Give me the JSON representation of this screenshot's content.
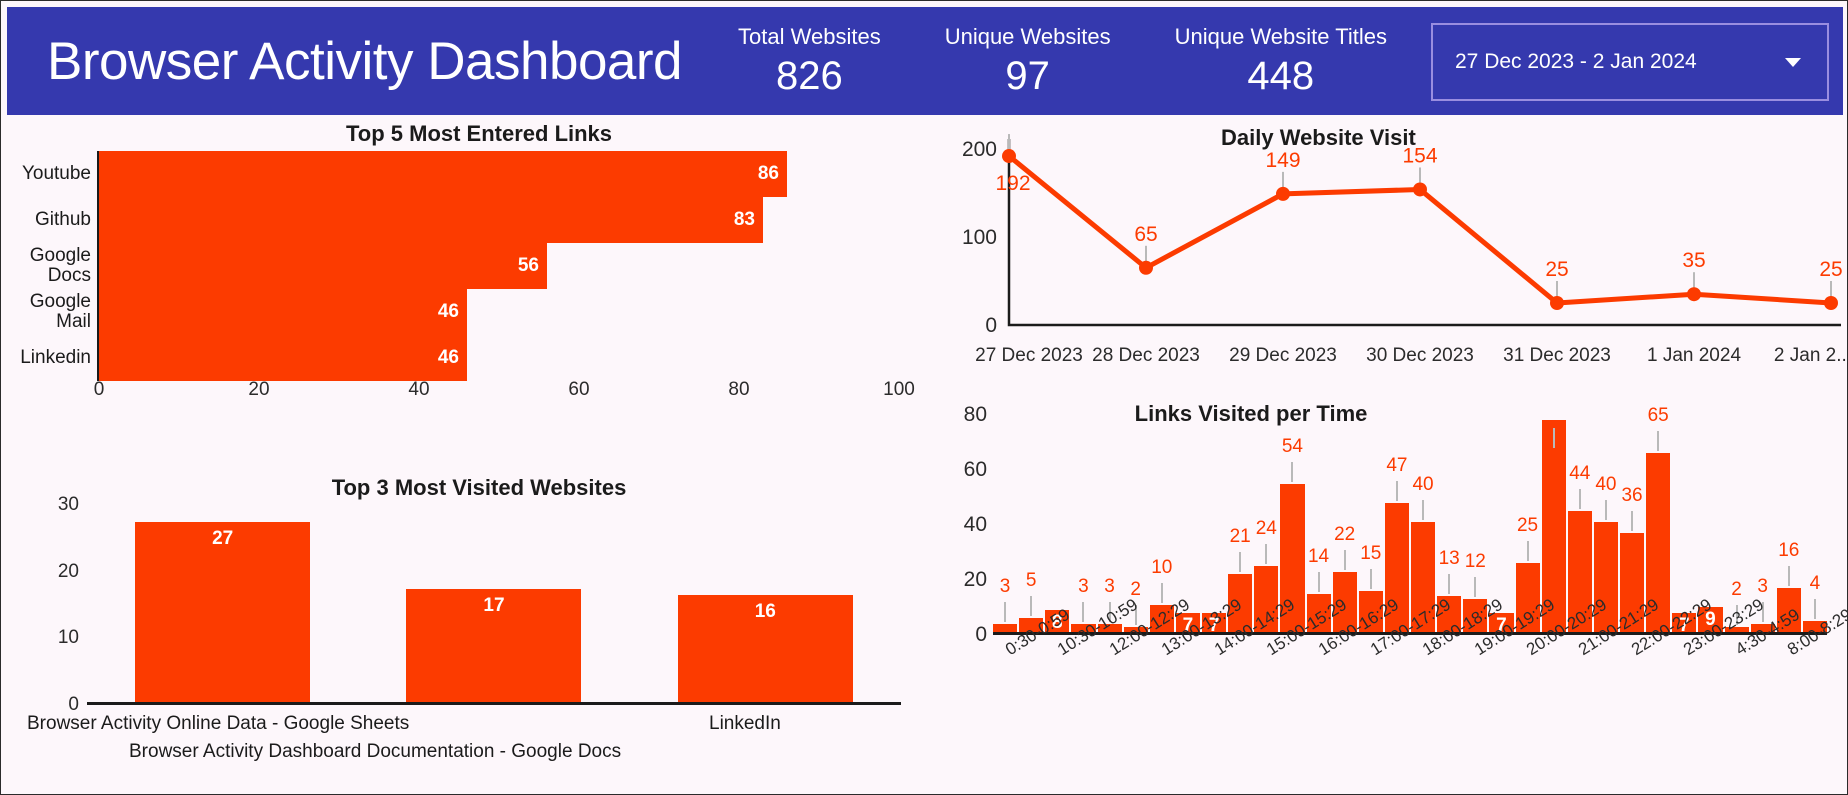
{
  "header": {
    "title": "Browser Activity Dashboard",
    "kpis": [
      {
        "label": "Total Websites",
        "value": "826"
      },
      {
        "label": "Unique Websites",
        "value": "97"
      },
      {
        "label": "Unique Website Titles",
        "value": "448"
      }
    ],
    "date_range": "27 Dec 2023 - 2 Jan 2024",
    "caret_icon": "chevron-down-icon",
    "background_color": "#3539AE",
    "accent_color": "#FC3B00"
  },
  "chart_data": [
    {
      "id": "top5_entered_links",
      "type": "bar",
      "orientation": "horizontal",
      "title": "Top 5 Most Entered Links",
      "categories": [
        "Youtube",
        "Github",
        "Google Docs",
        "Google Mail",
        "Linkedin"
      ],
      "values": [
        86,
        83,
        56,
        46,
        46
      ],
      "xlabel": "",
      "ylabel": "",
      "xlim": [
        0,
        100
      ],
      "xticks": [
        0,
        20,
        40,
        60,
        80,
        100
      ],
      "grid": false,
      "legend": false,
      "bar_color": "#FC3B00"
    },
    {
      "id": "top3_most_visited_websites",
      "type": "bar",
      "orientation": "vertical",
      "title": "Top 3 Most Visited Websites",
      "categories": [
        "Browser Activity Online Data - Google Sheets",
        "Browser Activity Dashboard Documentation - Google Docs",
        "LinkedIn"
      ],
      "values": [
        27,
        17,
        16
      ],
      "xlabel": "",
      "ylabel": "",
      "ylim": [
        0,
        30
      ],
      "yticks": [
        0,
        10,
        20,
        30
      ],
      "grid": false,
      "legend": false,
      "bar_color": "#FC3B00"
    },
    {
      "id": "daily_website_visit",
      "type": "line",
      "title": "Daily Website Visit",
      "x": [
        "27 Dec 2023",
        "28 Dec 2023",
        "29 Dec 2023",
        "30 Dec 2023",
        "31 Dec 2023",
        "1 Jan 2024",
        "2 Jan 2..."
      ],
      "values": [
        192,
        65,
        149,
        154,
        25,
        35,
        25
      ],
      "data_labels": [
        "192",
        "65",
        "149",
        "154",
        "25",
        "35",
        "25"
      ],
      "xlabel": "",
      "ylabel": "",
      "ylim": [
        0,
        200
      ],
      "yticks": [
        0,
        100,
        200
      ],
      "grid": false,
      "legend": false,
      "line_color": "#FC3B00"
    },
    {
      "id": "links_visited_per_time",
      "type": "bar",
      "orientation": "vertical",
      "title": "Links Visited per Time",
      "categories": [
        "0:30-0:59",
        "",
        "10:30-10:59",
        "",
        "12:00-12:29",
        "",
        "13:00-13:29",
        "",
        "14:00-14:29",
        "",
        "15:00-15:29",
        "",
        "16:00-16:29",
        "",
        "17:00-17:29",
        "",
        "18:00-18:29",
        "",
        "19:00-19:29",
        "",
        "20:00-20:29",
        "",
        "21:00-21:29",
        "",
        "22:00-22:29",
        "",
        "23:00-23:29",
        "",
        "4:30-4:59",
        "",
        "8:00-8:29",
        ""
      ],
      "tick_labels": [
        "0:30-0:59",
        "10:30-10:59",
        "12:00-12:29",
        "13:00-13:29",
        "14:00-14:29",
        "15:00-15:29",
        "16:00-16:29",
        "17:00-17:29",
        "18:00-18:29",
        "19:00-19:29",
        "20:00-20:29",
        "21:00-21:29",
        "22:00-22:29",
        "23:00-23:29",
        "4:30-4:59",
        "8:00-8:29"
      ],
      "values": [
        3,
        5,
        8,
        3,
        3,
        2,
        10,
        7,
        7,
        21,
        24,
        54,
        14,
        22,
        15,
        47,
        40,
        13,
        12,
        7,
        25,
        77,
        44,
        40,
        36,
        65,
        7,
        9,
        2,
        3,
        16,
        4
      ],
      "xlabel": "",
      "ylabel": "",
      "ylim": [
        0,
        80
      ],
      "yticks": [
        0,
        20,
        40,
        60,
        80
      ],
      "grid": false,
      "legend": false,
      "bar_color": "#FC3B00"
    }
  ]
}
